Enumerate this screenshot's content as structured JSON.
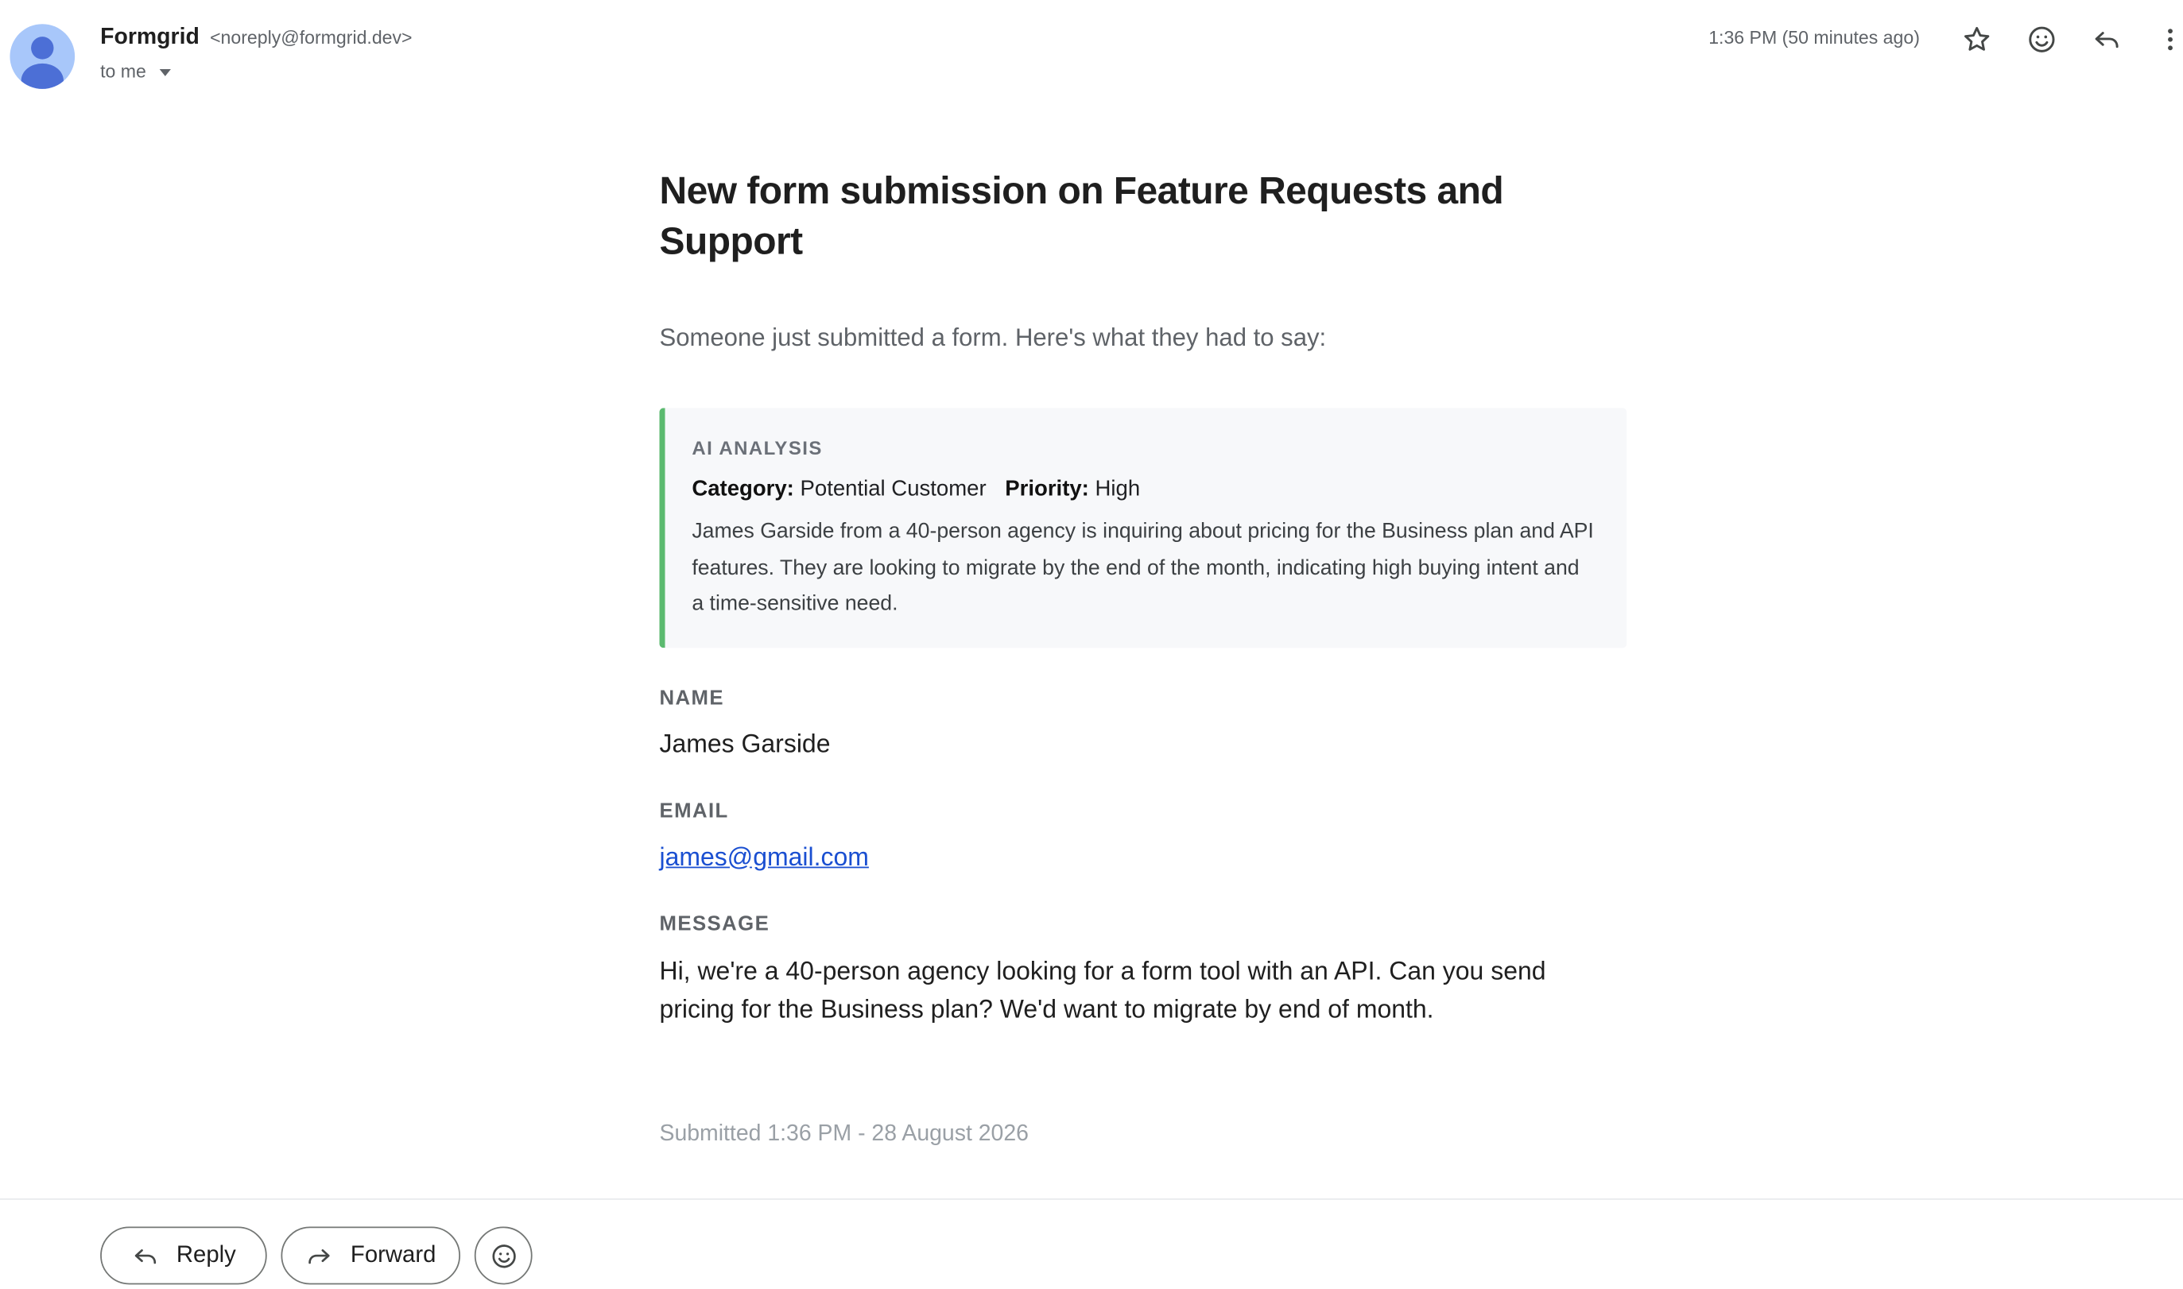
{
  "header": {
    "sender_name": "Formgrid",
    "sender_address": "<noreply@formgrid.dev>",
    "recipient": "to me",
    "timestamp": "1:36 PM (50 minutes ago)",
    "icons": [
      "star-icon",
      "emoji-icon",
      "reply-icon",
      "more-vert-icon"
    ]
  },
  "email": {
    "title": "New form submission on Feature Requests and Support",
    "intro": "Someone just submitted a form. Here's what they had to say:",
    "ai_analysis": {
      "heading": "AI ANALYSIS",
      "category_label": "Category:",
      "category_value": "Potential Customer",
      "priority_label": "Priority:",
      "priority_value": "High",
      "summary": "James Garside from a 40-person agency is inquiring about pricing for the Business plan and API features. They are looking to migrate by the end of the month, indicating high buying intent and a time-sensitive need."
    },
    "fields": {
      "name_label": "NAME",
      "name_value": "James Garside",
      "email_label": "EMAIL",
      "email_value": "james@gmail.com",
      "message_label": "MESSAGE",
      "message_value": "Hi, we're a 40-person agency looking for a form tool with an API. Can you send pricing for the Business plan? We'd want to migrate by end of month."
    },
    "submitted": "Submitted 1:36 PM - 28 August 2026"
  },
  "footer": {
    "reply_label": "Reply",
    "forward_label": "Forward"
  },
  "colors": {
    "accent_bar": "#5bba6f",
    "link": "#1a4fd1",
    "avatar_bg": "#a8c7fa",
    "avatar_fg": "#4c6fd6"
  }
}
